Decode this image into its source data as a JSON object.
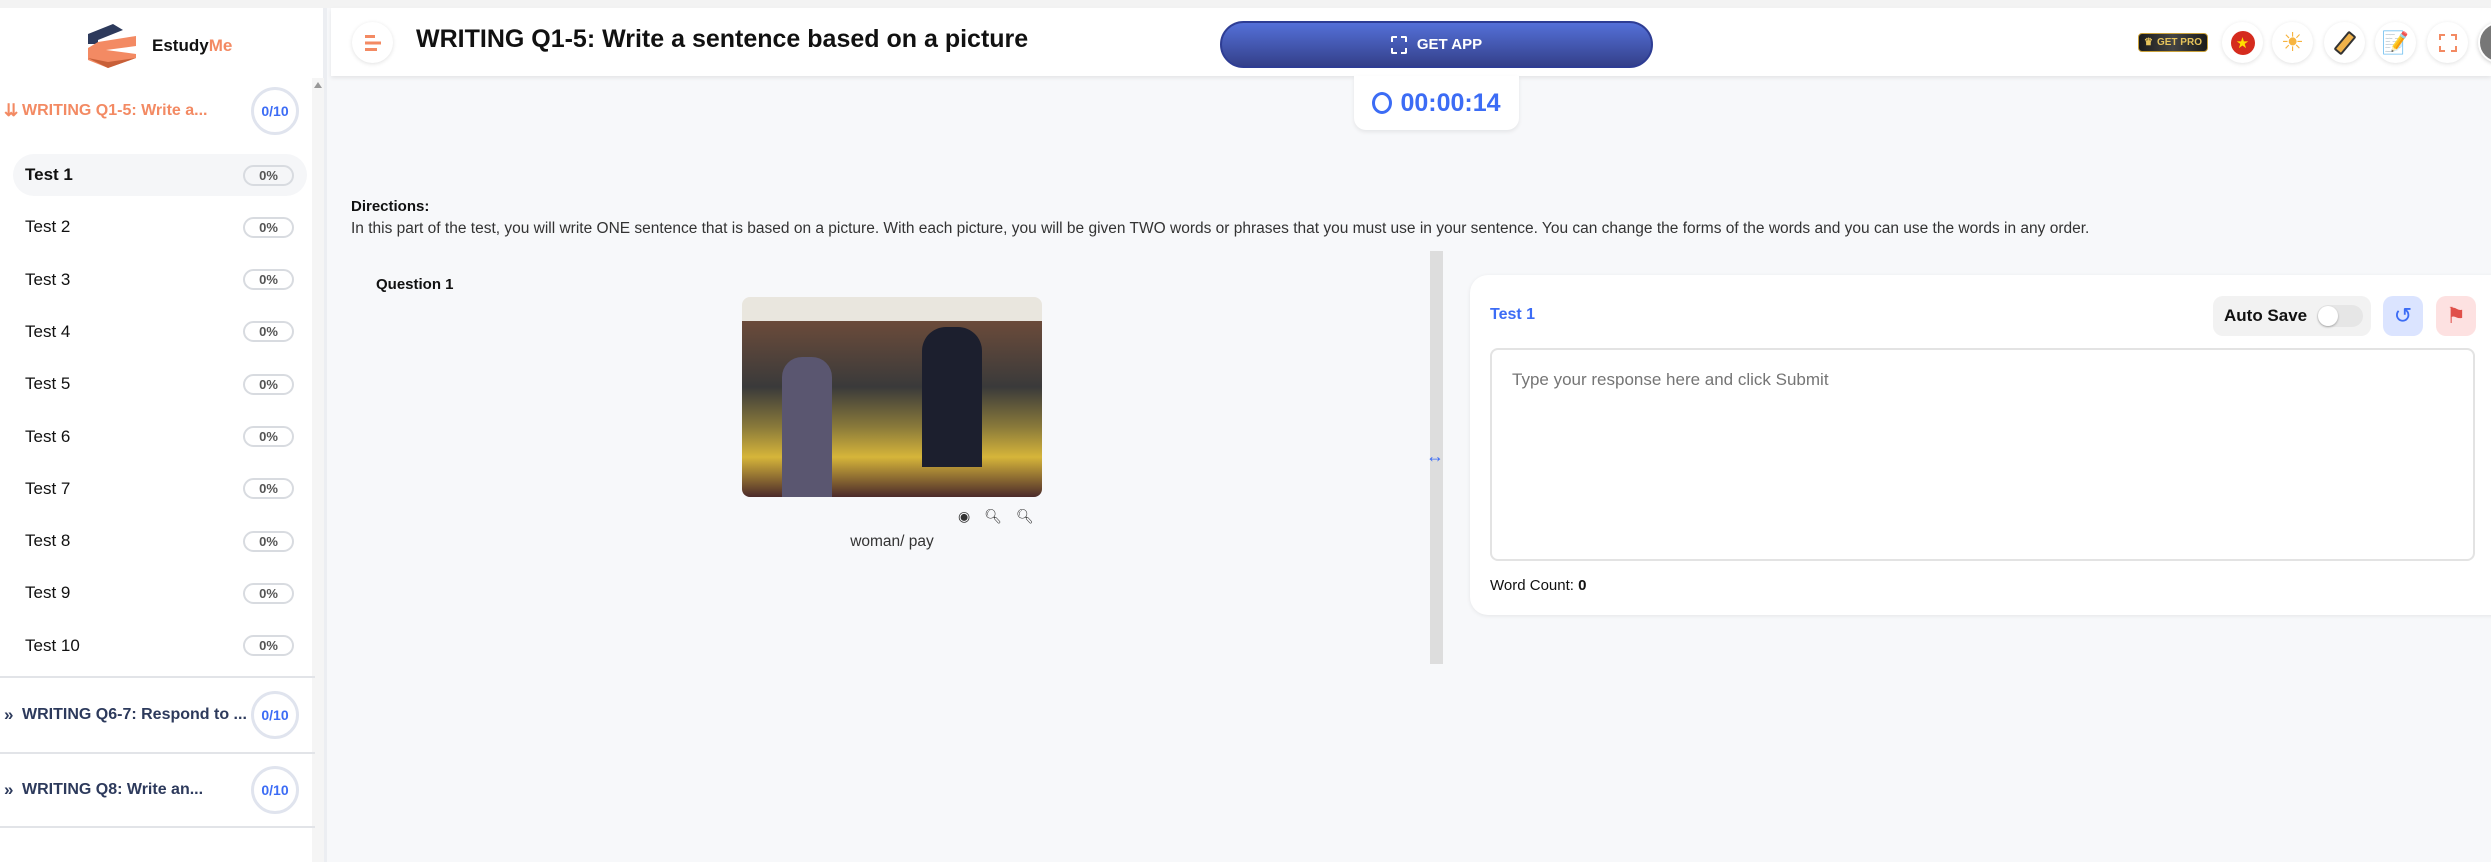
{
  "brand": {
    "name_a": "Estudy",
    "name_b": "Me"
  },
  "sidebar": {
    "sections": [
      {
        "label": "WRITING Q1-5: Write a...",
        "progress": "0/10",
        "expanded": true
      },
      {
        "label": "WRITING Q6-7: Respond to ...",
        "progress": "0/10",
        "expanded": false
      },
      {
        "label": "WRITING Q8: Write an...",
        "progress": "0/10",
        "expanded": false
      }
    ],
    "tests": [
      {
        "label": "Test 1",
        "pct": "0%"
      },
      {
        "label": "Test 2",
        "pct": "0%"
      },
      {
        "label": "Test 3",
        "pct": "0%"
      },
      {
        "label": "Test 4",
        "pct": "0%"
      },
      {
        "label": "Test 5",
        "pct": "0%"
      },
      {
        "label": "Test 6",
        "pct": "0%"
      },
      {
        "label": "Test 7",
        "pct": "0%"
      },
      {
        "label": "Test 8",
        "pct": "0%"
      },
      {
        "label": "Test 9",
        "pct": "0%"
      },
      {
        "label": "Test 10",
        "pct": "0%"
      }
    ]
  },
  "header": {
    "title": "WRITING Q1-5: Write a sentence based on a picture",
    "get_app": "GET APP",
    "get_pro": "GET PRO"
  },
  "timer": "00:00:14",
  "directions": {
    "heading": "Directions:",
    "text": "In this part of the test, you will write ONE sentence that is based on a picture. With each picture, you will be given TWO words or phrases that you must use in your sentence. You can change the forms of the words and you can use the words in any order."
  },
  "question": {
    "label": "Question 1",
    "keywords": "woman/ pay"
  },
  "answer": {
    "title": "Test 1",
    "auto_save": "Auto Save",
    "auto_save_on": false,
    "placeholder": "Type your response here and click Submit",
    "word_count_label": "Word Count:",
    "word_count": "0"
  },
  "colors": {
    "accent": "#3c6cf5",
    "brand_orange": "#f38a63",
    "navy": "#2d3a5c"
  }
}
